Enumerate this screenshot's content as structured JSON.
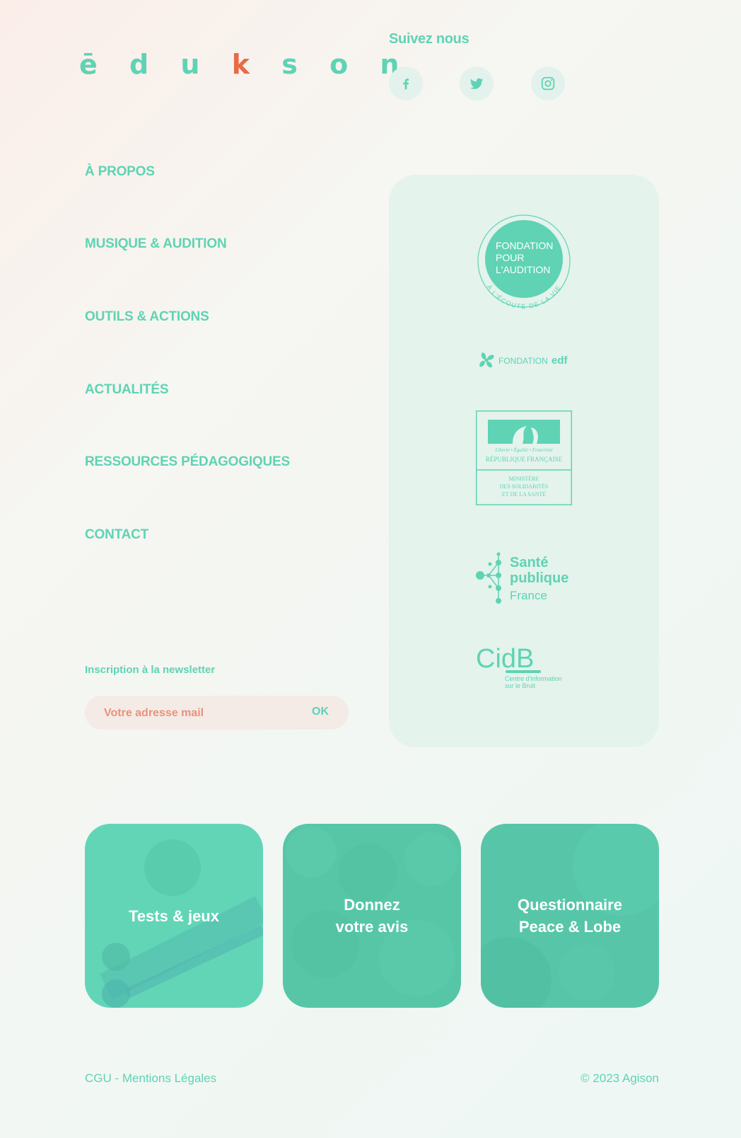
{
  "brand": {
    "logo_text": "ēduk",
    "logo_k": "",
    "logo_rest": "son"
  },
  "social": {
    "title": "Suivez nous",
    "items": [
      "facebook-icon",
      "twitter-icon",
      "instagram-icon"
    ]
  },
  "nav": {
    "items": [
      {
        "label": "À PROPOS"
      },
      {
        "label": "MUSIQUE & AUDITION"
      },
      {
        "label": "OUTILS & ACTIONS"
      },
      {
        "label": "ACTUALITÉS"
      },
      {
        "label": "RESSOURCES PÉDAGOGIQUES"
      },
      {
        "label": "CONTACT"
      }
    ]
  },
  "newsletter": {
    "title": "Inscription à la newsletter",
    "placeholder": "Votre adresse mail",
    "button": "OK"
  },
  "partners": {
    "fondation_audition": {
      "line1": "FONDATION",
      "line2": "POUR",
      "line3": "L'AUDITION",
      "ring": "À L'ÉCOUTE DE LA VIE"
    },
    "fondation_edf": {
      "prefix": "FONDATION",
      "brand": "edf"
    },
    "ministere": {
      "motto": "Liberté • Égalité • Fraternité",
      "republique": "RÉPUBLIQUE FRANÇAISE",
      "line1": "MINISTÈRE",
      "line2": "DES SOLIDARITÉS",
      "line3": "ET DE LA SANTÉ"
    },
    "sante_publique": {
      "line1": "Santé",
      "line2": "publique",
      "line3": "France"
    },
    "cidb": {
      "name": "CidB",
      "line1": "Centre d'information",
      "line2": "sur le Bruit"
    }
  },
  "cards": [
    {
      "label": "Tests & jeux"
    },
    {
      "label": "Donnez\nvotre avis"
    },
    {
      "label": "Questionnaire\nPeace & Lobe"
    }
  ],
  "footer": {
    "legal": "CGU - Mentions Légales",
    "copyright": "© 2023 Agison"
  },
  "colors": {
    "mint": "#5fd3b4",
    "orange": "#e86a46",
    "peach_text": "#e8937a"
  }
}
